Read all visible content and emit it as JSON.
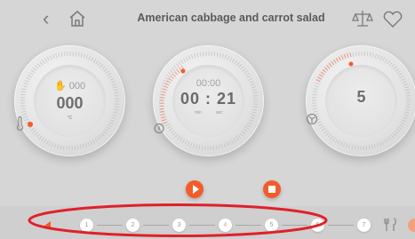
{
  "header": {
    "title": "American cabbage and carrot salad",
    "back_icon": "chevron-left-icon",
    "home_icon": "home-icon",
    "scale_icon": "scale-icon",
    "favorite_icon": "heart-icon"
  },
  "dials": {
    "temperature": {
      "speed_label": "000",
      "value": "000",
      "unit": "°C",
      "icon": "thermometer-icon"
    },
    "time": {
      "preset": "00:00",
      "value": "00 : 21",
      "min_label": "min",
      "sec_label": "sec",
      "icon": "timer-icon"
    },
    "speed": {
      "value": "5",
      "icon": "fan-icon"
    }
  },
  "controls": {
    "play_icon": "play-icon",
    "stop_icon": "stop-icon"
  },
  "steps": {
    "items": [
      "1",
      "2",
      "3",
      "4",
      "5",
      "6",
      "7"
    ],
    "active": "4",
    "prev_icon": "prev-arrow-icon",
    "tools_icon": "utensils-icon"
  },
  "colors": {
    "accent": "#f25c2a",
    "background": "#d6d6d6",
    "highlight": "#e0202a"
  }
}
